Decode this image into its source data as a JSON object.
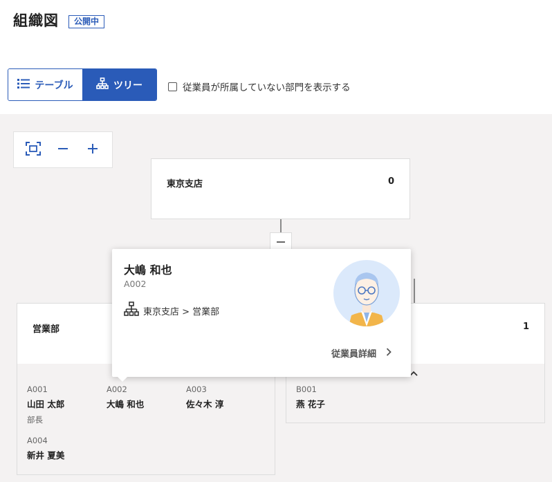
{
  "page": {
    "title": "組織図",
    "status_badge": "公開中"
  },
  "view_toggle": {
    "table_label": "テーブル",
    "tree_label": "ツリー",
    "active": "tree"
  },
  "filter": {
    "show_empty_departments_label": "従業員が所属していない部門を表示する",
    "checked": false
  },
  "zoom_controls": {
    "icons": [
      "fit-screen-icon",
      "zoom-out-icon",
      "zoom-in-icon"
    ]
  },
  "org": {
    "root": {
      "name": "東京支店",
      "count": "0"
    },
    "departments": [
      {
        "name": "営業部",
        "members": [
          {
            "id": "A001",
            "name": "山田 太郎",
            "role": "部長"
          },
          {
            "id": "A002",
            "name": "大嶋 和也",
            "role": ""
          },
          {
            "id": "A003",
            "name": "佐々木 淳",
            "role": ""
          },
          {
            "id": "A004",
            "name": "新井 夏美",
            "role": ""
          }
        ]
      },
      {
        "name": "",
        "count": "1",
        "members": [
          {
            "id": "B001",
            "name": "燕 花子",
            "role": ""
          }
        ]
      }
    ]
  },
  "popup": {
    "name": "大嶋 和也",
    "id": "A002",
    "path": "東京支店 > 営業部",
    "detail_link": "従業員詳細"
  },
  "colors": {
    "accent": "#2a5bb8",
    "canvas_bg": "#f4f2f2"
  }
}
